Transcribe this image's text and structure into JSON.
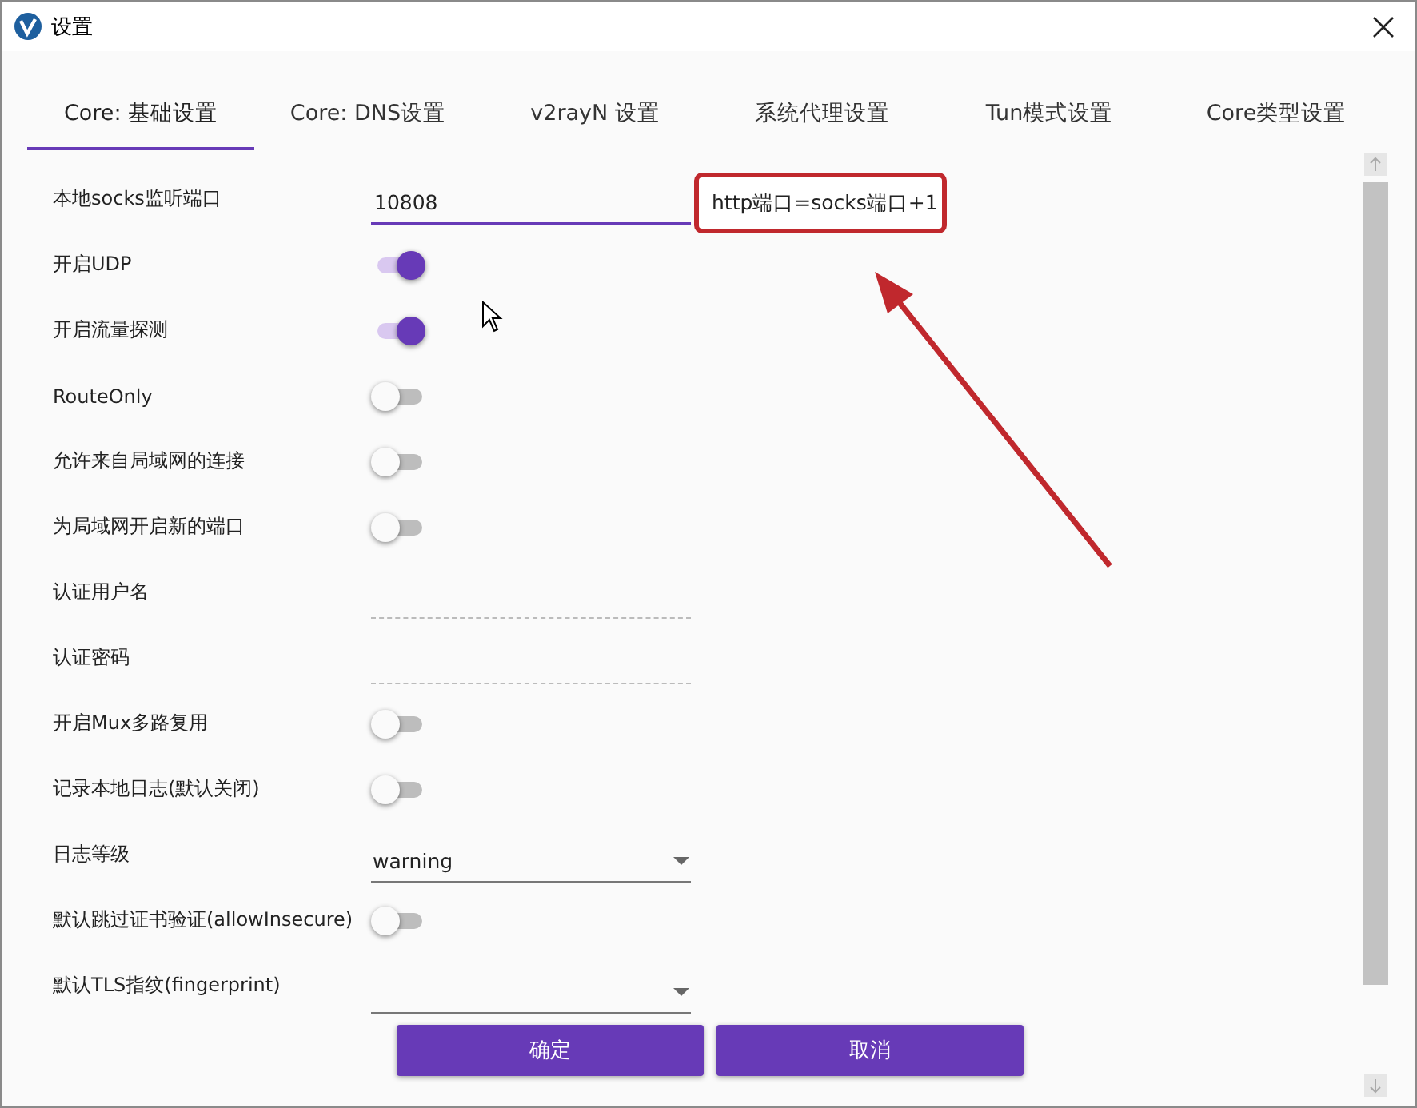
{
  "window": {
    "title": "设置"
  },
  "tabs": [
    {
      "label": "Core: 基础设置",
      "selected": true
    },
    {
      "label": "Core: DNS设置",
      "selected": false
    },
    {
      "label": "v2rayN 设置",
      "selected": false
    },
    {
      "label": "系统代理设置",
      "selected": false
    },
    {
      "label": "Tun模式设置",
      "selected": false
    },
    {
      "label": "Core类型设置",
      "selected": false
    }
  ],
  "rows": [
    {
      "label": "本地socks监听端口",
      "kind": "input",
      "value": "10808",
      "focused": true
    },
    {
      "label": "开启UDP",
      "kind": "toggle",
      "on": true
    },
    {
      "label": "开启流量探测",
      "kind": "toggle",
      "on": true
    },
    {
      "label": "RouteOnly",
      "kind": "toggle",
      "on": false
    },
    {
      "label": "允许来自局域网的连接",
      "kind": "toggle",
      "on": false
    },
    {
      "label": "为局域网开启新的端口",
      "kind": "toggle",
      "on": false
    },
    {
      "label": "认证用户名",
      "kind": "input",
      "focused": false
    },
    {
      "label": "认证密码",
      "kind": "input",
      "focused": false
    },
    {
      "label": "开启Mux多路复用",
      "kind": "toggle",
      "on": false
    },
    {
      "label": "记录本地日志(默认关闭)",
      "kind": "toggle",
      "on": false
    },
    {
      "label": "日志等级",
      "kind": "dropdown",
      "value": "warning"
    },
    {
      "label": "默认跳过证书验证(allowInsecure)",
      "kind": "toggle",
      "on": false
    },
    {
      "label": "默认TLS指纹(fingerprint)",
      "kind": "dropdown"
    }
  ],
  "annotation": {
    "text": "http端口=socks端口+1"
  },
  "buttons": [
    "确定",
    "取消"
  ]
}
